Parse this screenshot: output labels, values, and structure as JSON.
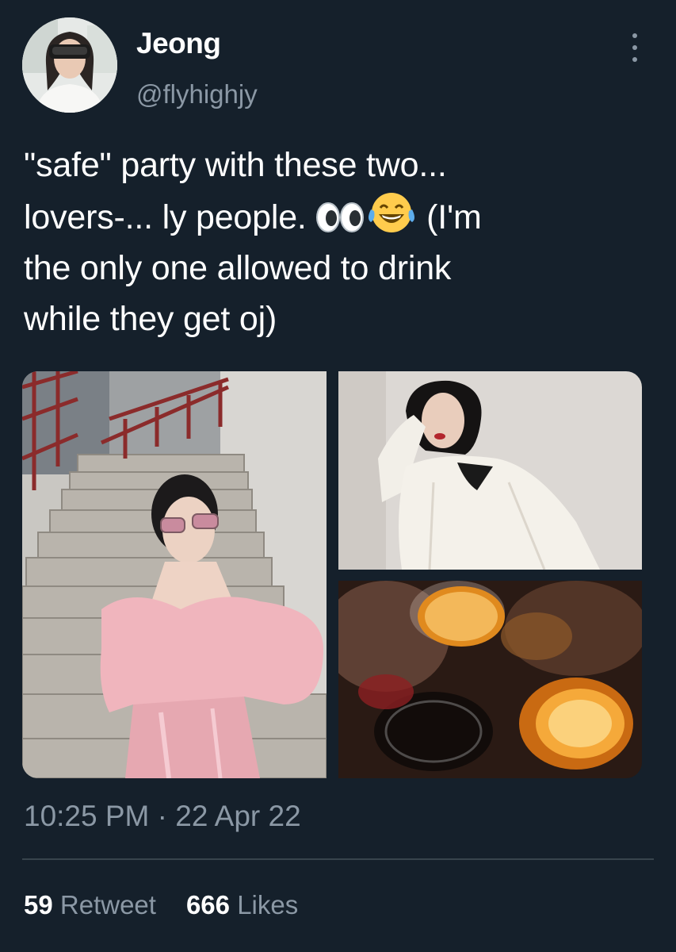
{
  "user": {
    "display_name": "Jeong",
    "handle": "@flyhighjy"
  },
  "tweet": {
    "line1": "\"safe\" party with these two...",
    "line2_before": "lovers-... ly people. ",
    "line2_after": " (I'm",
    "line3": "the only one allowed to drink",
    "line4": "while they get oj)",
    "emojis": [
      "eyes-emoji",
      "tears-of-joy-emoji"
    ]
  },
  "timestamp": "10:25 PM · 22 Apr 22",
  "stats": {
    "retweets_count": "59",
    "retweets_label": "Retweet",
    "likes_count": "666",
    "likes_label": "Likes"
  },
  "colors": {
    "background": "#15202b",
    "text_primary": "#ffffff",
    "text_secondary": "#8b98a5",
    "divider": "#38444d"
  }
}
